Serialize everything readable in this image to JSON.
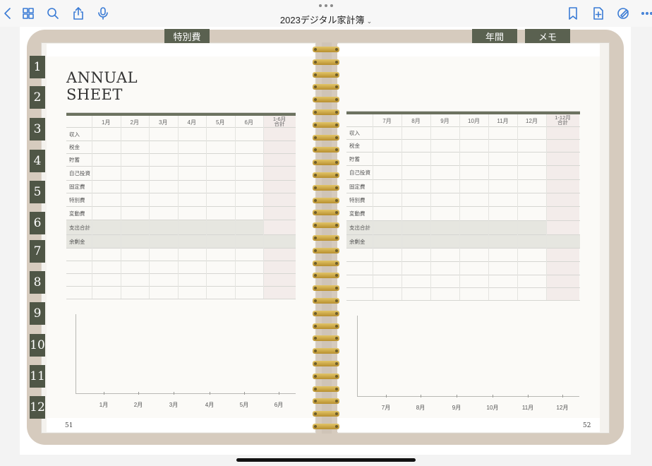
{
  "toolbar": {
    "title": "2023デジタル家計簿",
    "title_chevron": "⌄",
    "icons": [
      "back-chevron-icon",
      "grid-icon",
      "search-icon",
      "share-icon",
      "microphone-icon",
      "bookmark-icon",
      "add-page-icon",
      "pencil-circle-icon",
      "more-icon"
    ],
    "accent": "#3a7bd5"
  },
  "top_tabs": [
    {
      "label": "特別費"
    },
    {
      "label": "年間"
    },
    {
      "label": "メモ"
    }
  ],
  "month_tabs": [
    "1",
    "2",
    "3",
    "4",
    "5",
    "6",
    "7",
    "8",
    "9",
    "10",
    "11",
    "12"
  ],
  "left_page": {
    "title_line1": "ANNUAL",
    "title_line2": "SHEET",
    "columns": [
      "1月",
      "2月",
      "3月",
      "4月",
      "5月",
      "6月"
    ],
    "total_label_1": "1-6月",
    "total_label_2": "合計",
    "rows": [
      "収入",
      "税金",
      "貯蓄",
      "自己投資",
      "固定費",
      "特別費",
      "変動費",
      "支出合計",
      "余剰金"
    ],
    "graph_labels": [
      "1月",
      "2月",
      "3月",
      "4月",
      "5月",
      "6月"
    ],
    "page_number": "51"
  },
  "right_page": {
    "columns": [
      "7月",
      "8月",
      "9月",
      "10月",
      "11月",
      "12月"
    ],
    "total_label_1": "1-12月",
    "total_label_2": "合計",
    "rows": [
      "収入",
      "税金",
      "貯蓄",
      "自己投資",
      "固定費",
      "特別費",
      "変動費",
      "支出合計",
      "余剰金"
    ],
    "graph_labels": [
      "7月",
      "8月",
      "9月",
      "10月",
      "11月",
      "12月"
    ],
    "page_number": "52"
  },
  "colors": {
    "tab_green": "#4f5646",
    "binder": "#d6cbbe",
    "total_col": "#f3ecea",
    "gold_ring": "#d2b050"
  }
}
